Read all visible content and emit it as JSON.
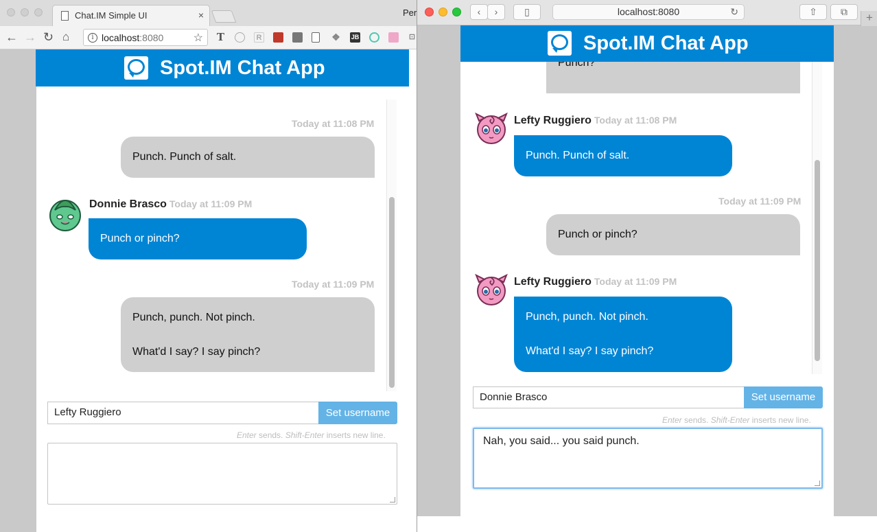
{
  "chrome": {
    "tab_title": "Chat.IM Simple UI",
    "tab_close": "×",
    "right_text": "Per",
    "url_host": "localhost",
    "url_port": ":8080",
    "star": "☆"
  },
  "safari": {
    "url": "localhost:8080",
    "reload": "↻",
    "new_tab": "+"
  },
  "app": {
    "title": "Spot.IM Chat App",
    "brand_color": "#0085d5"
  },
  "left_chat": {
    "messages": [
      {
        "timestamp": "Today at 11:08 PM",
        "text": "Punch. Punch of salt."
      },
      {
        "author": "Donnie Brasco",
        "timestamp": "Today at 11:09 PM",
        "text": "Punch or pinch?"
      },
      {
        "timestamp": "Today at 11:09 PM",
        "lines": [
          "Punch, punch. Not pinch.",
          "What'd I say? I say pinch?"
        ]
      }
    ],
    "username_value": "Lefty Ruggiero",
    "set_username_label": "Set username",
    "hint": {
      "enter": "Enter",
      "sends": " sends. ",
      "shift_enter": "Shift-Enter",
      "inserts": " inserts new line."
    },
    "message_value": ""
  },
  "right_chat": {
    "messages": [
      {
        "text": "Punch?"
      },
      {
        "author": "Lefty Ruggiero",
        "timestamp": "Today at 11:08 PM",
        "text": "Punch. Punch of salt."
      },
      {
        "timestamp": "Today at 11:09 PM",
        "text": "Punch or pinch?"
      },
      {
        "author": "Lefty Ruggiero",
        "timestamp": "Today at 11:09 PM",
        "lines": [
          "Punch, punch. Not pinch.",
          "What'd I say? I say pinch?"
        ]
      }
    ],
    "username_value": "Donnie Brasco",
    "set_username_label": "Set username",
    "hint": {
      "enter": "Enter",
      "sends": " sends. ",
      "shift_enter": "Shift-Enter",
      "inserts": " inserts new line."
    },
    "message_value": "Nah, you said... you said punch."
  }
}
